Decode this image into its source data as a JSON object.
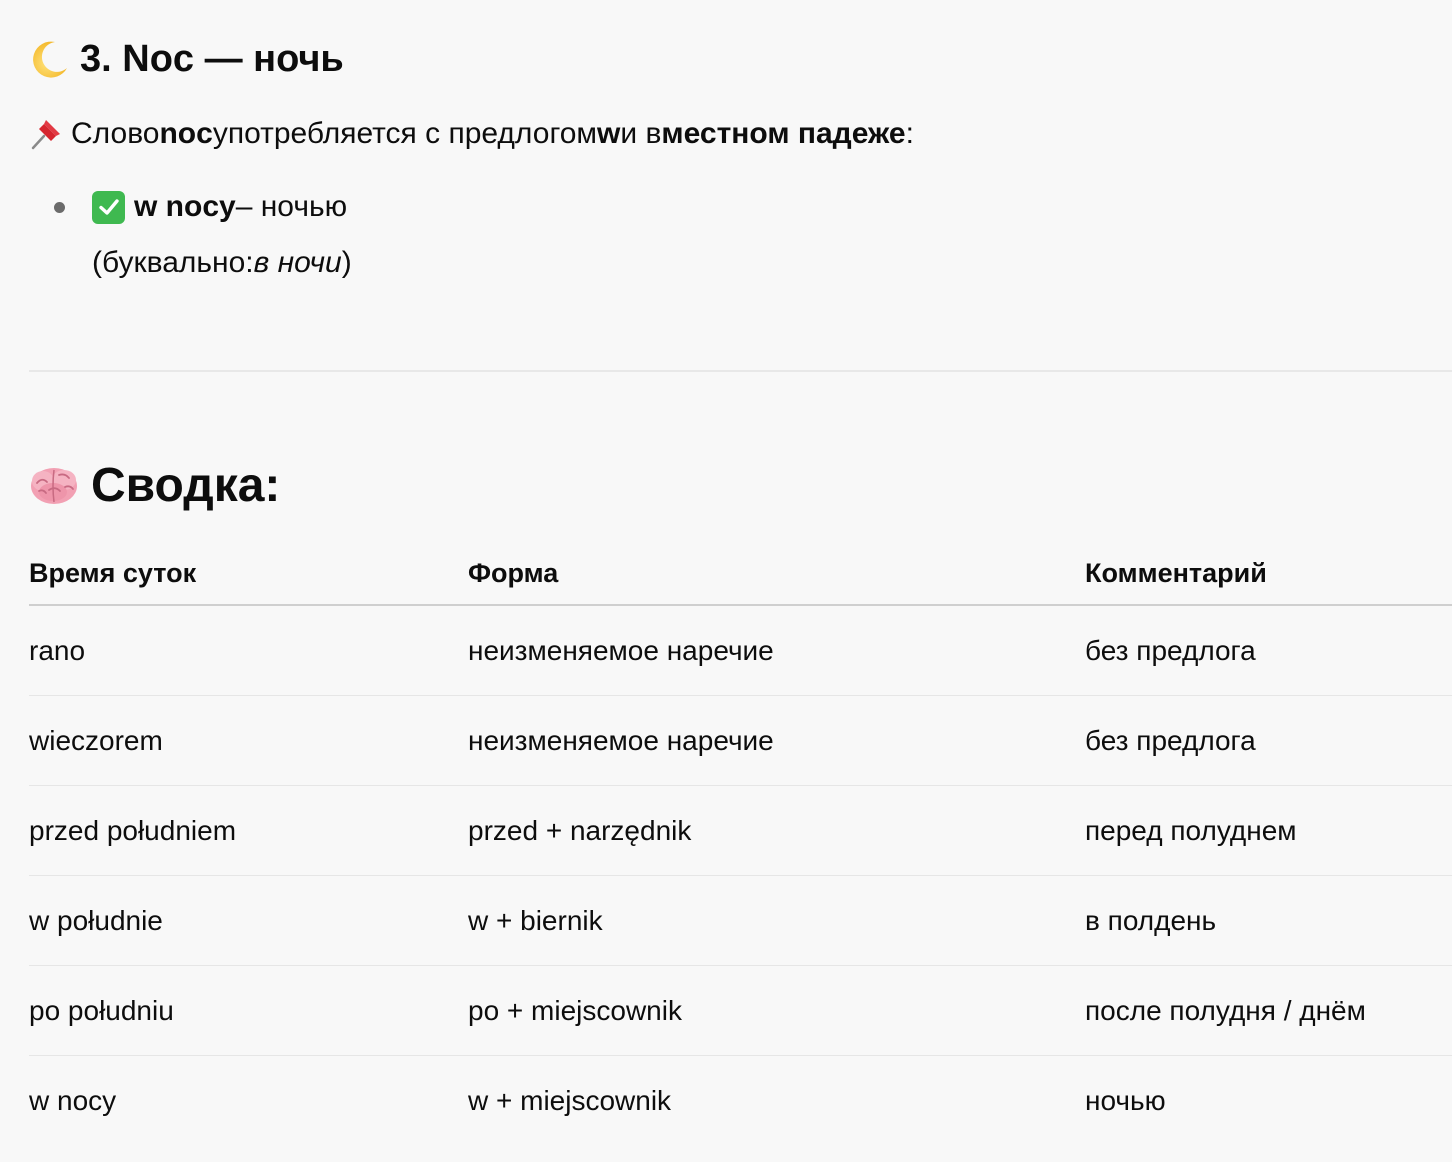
{
  "section3": {
    "icon": "crescent-moon-icon",
    "heading": "3. Noc — ночь"
  },
  "note": {
    "icon": "pushpin-icon",
    "text1": "Слово ",
    "bold1": "noc",
    "text2": " употребляется с предлогом ",
    "bold2": "w",
    "text3": " и в ",
    "bold3": "местном падеже",
    "text4": ":"
  },
  "bullet": {
    "icon": "check-mark-button-icon",
    "term": "w nocy",
    "dash_meaning": " – ночью",
    "literal_prefix": "(буквально: ",
    "literal_value": "в ночи",
    "literal_suffix": ")"
  },
  "summary": {
    "icon": "brain-icon",
    "heading": "Сводка:"
  },
  "table": {
    "headers": [
      "Время суток",
      "Форма",
      "Комментарий"
    ],
    "rows": [
      [
        "rano",
        "неизменяемое наречие",
        "без предлога"
      ],
      [
        "wieczorem",
        "неизменяемое наречие",
        "без предлога"
      ],
      [
        "przed południem",
        "przed + narzędnik",
        "перед полуднем"
      ],
      [
        "w południe",
        "w + biernik",
        "в полдень"
      ],
      [
        "po południu",
        "po + miejscownik",
        "после полудня / днём"
      ],
      [
        "w nocy",
        "w + miejscownik",
        "ночью"
      ]
    ]
  },
  "colors": {
    "background": "#f8f8f8",
    "text": "#0d0d0d",
    "check_green": "#3fb950",
    "divider": "#e8e8e8"
  }
}
